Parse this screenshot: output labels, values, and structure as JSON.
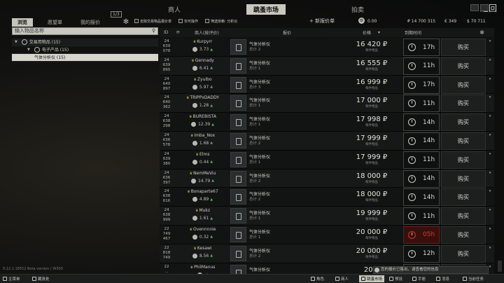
{
  "top_tabs": [
    "商人",
    "跳蚤市场",
    "拍卖"
  ],
  "active_top_tab": 1,
  "return_label": "返回",
  "subtabs": [
    "浏览",
    "愿望单",
    "我的报价"
  ],
  "badge_13": "1/3",
  "search_placeholder": "输入物品名称",
  "tree": [
    {
      "label": "交易用物品 (15)",
      "level": 0
    },
    {
      "label": "电子产品 (15)",
      "level": 1
    },
    {
      "label": "气体分析仪 (15)",
      "level": 2
    }
  ],
  "version": "0.12.1.18552 Beta version | W300",
  "filters": [
    "去除交易物品报价单",
    "仅可操作",
    "筛选依赖: 分析仪"
  ],
  "add_offer": "+ 新报价单",
  "balance": "0.00",
  "money": {
    "rub": "₽ 14 700 315",
    "eur": "€ 349",
    "usd": "$ 70 711"
  },
  "columns": {
    "id": "ID",
    "seller": "商人(按评价)",
    "offer": "报价",
    "price": "价格",
    "time": "到期时间"
  },
  "rows": [
    {
      "id": "24\n639\n078",
      "seller": "Kurpyrr",
      "rating": "3.73",
      "item": "气体分析仪",
      "qty": "总计 2",
      "price": "16 420 ₽",
      "sub": "每件物品",
      "time": "17h",
      "buy": "购买",
      "expiring": false
    },
    {
      "id": "24\n639\n895",
      "seller": "Gennady",
      "rating": "6.41",
      "item": "气体分析仪",
      "qty": "总计 1",
      "price": "16 555 ₽",
      "sub": "每件物品",
      "time": "11h",
      "buy": "购买",
      "expiring": false
    },
    {
      "id": "24\n640\n897",
      "seller": "Zyuibo",
      "rating": "5.97",
      "item": "气体分析仪",
      "qty": "总计 3",
      "price": "16 999 ₽",
      "sub": "每件物品",
      "time": "17h",
      "buy": "购买",
      "expiring": false
    },
    {
      "id": "24\n640\n362",
      "seller": "TRIPPxDADDY",
      "rating": "1.28",
      "item": "气体分析仪",
      "qty": "总计 1",
      "price": "17 000 ₽",
      "sub": "每件物品",
      "time": "11h",
      "buy": "购买",
      "expiring": false
    },
    {
      "id": "24\n638\n298",
      "seller": "BUREBISTA",
      "rating": "12.39",
      "item": "气体分析仪",
      "qty": "总计 1",
      "price": "17 998 ₽",
      "sub": "每件物品",
      "time": "14h",
      "buy": "购买",
      "expiring": false
    },
    {
      "id": "24\n636\n578",
      "seller": "Imba_Nox",
      "rating": "1.68",
      "item": "气体分析仪",
      "qty": "总计 2",
      "price": "17 999 ₽",
      "sub": "每件物品",
      "time": "14h",
      "buy": "购买",
      "expiring": false
    },
    {
      "id": "24\n639\n380",
      "seller": "Elms",
      "rating": "0.44",
      "item": "气体分析仪",
      "qty": "总计 1",
      "price": "17 999 ₽",
      "sub": "每件物品",
      "time": "11h",
      "buy": "购买",
      "expiring": false
    },
    {
      "id": "24\n636\n397",
      "seller": "NemMeViu",
      "rating": "14.79",
      "item": "气体分析仪",
      "qty": "总计 2",
      "price": "18 000 ₽",
      "sub": "每件物品",
      "time": "14h",
      "buy": "购买",
      "expiring": false
    },
    {
      "id": "24\n638\n616",
      "seller": "Bonaparte67",
      "rating": "4.89",
      "item": "气体分析仪",
      "qty": "总计 2",
      "price": "18 000 ₽",
      "sub": "每件物品",
      "time": "14h",
      "buy": "购买",
      "expiring": false
    },
    {
      "id": "24\n638\n999",
      "seller": "Mukz",
      "rating": "1.61",
      "item": "气体分析仪",
      "qty": "总计 1",
      "price": "19 999 ₽",
      "sub": "每件物品",
      "time": "11h",
      "buy": "购买",
      "expiring": false
    },
    {
      "id": "22\n749\n467",
      "seller": "Ovennnnie",
      "rating": "0.32",
      "item": "气体分析仪",
      "qty": "总计 1",
      "price": "20 000 ₽",
      "sub": "每件物品",
      "time": "05h",
      "buy": "购买",
      "expiring": true
    },
    {
      "id": "22\n818\n749",
      "seller": "Kesawi",
      "rating": "8.56",
      "item": "气体分析仪",
      "qty": "总计 2",
      "price": "20 000 ₽",
      "sub": "每件物品",
      "time": "12h",
      "buy": "购买",
      "expiring": false
    },
    {
      "id": "22\n...",
      "seller": "PhilManus",
      "rating": "",
      "item": "气体分析仪",
      "qty": "",
      "price": "20 0",
      "sub": "",
      "time": "",
      "buy": "",
      "expiring": false
    }
  ],
  "bottom_bar": [
    {
      "label": "主菜单",
      "icon": "menu-icon"
    },
    {
      "label": "藏身处",
      "icon": "hideout-icon"
    },
    {
      "label": "角色",
      "icon": "character-icon"
    },
    {
      "label": "商人",
      "icon": "traders-icon"
    },
    {
      "label": "跳蚤市场",
      "icon": "flea-market-icon",
      "active": true
    },
    {
      "label": "预设",
      "icon": "presets-icon"
    },
    {
      "label": "手册",
      "icon": "handbook-icon"
    },
    {
      "label": "消息",
      "icon": "messages-icon"
    },
    {
      "label": "当前任务",
      "icon": "tasks-icon"
    }
  ],
  "notification": "您的报价已售出，请查看您的信息"
}
